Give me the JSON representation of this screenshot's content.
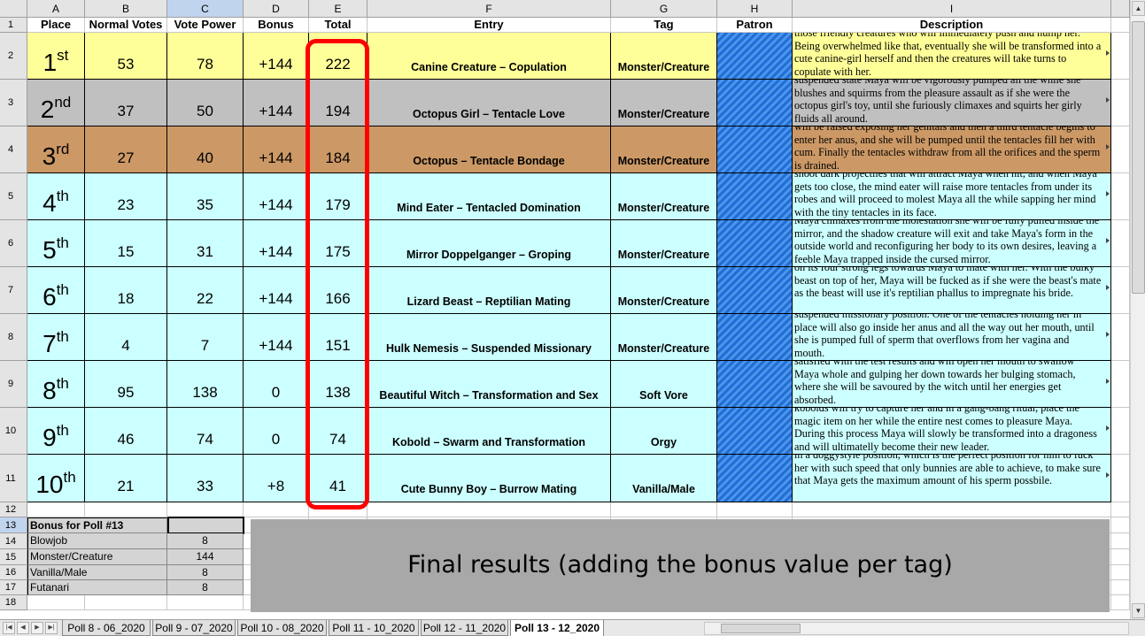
{
  "columns": [
    "A",
    "B",
    "C",
    "D",
    "E",
    "F",
    "G",
    "H",
    "I"
  ],
  "row_numbers": [
    "1",
    "2",
    "3",
    "4",
    "5",
    "6",
    "7",
    "8",
    "9",
    "10",
    "11",
    "12",
    "13",
    "14",
    "15",
    "16",
    "17",
    "18"
  ],
  "headers": {
    "place": "Place",
    "normal_votes": "Normal Votes",
    "vote_power": "Vote Power",
    "bonus": "Bonus",
    "total": "Total",
    "entry": "Entry",
    "tag": "Tag",
    "patron": "Patron",
    "description": "Description"
  },
  "rows": [
    {
      "place_num": "1",
      "place_suf": "st",
      "normal": "53",
      "power": "78",
      "bonus": "+144",
      "total": "222",
      "entry": "Canine Creature – Copulation",
      "tag": "Monster/Creature",
      "bg": "#ffff99",
      "desc": "those friendly creatures who will immediately push and hump her. Being overwhelmed like that, eventually she will be transformed into a cute canine-girl herself and then the creatures will take turns to copulate with her."
    },
    {
      "place_num": "2",
      "place_suf": "nd",
      "normal": "37",
      "power": "50",
      "bonus": "+144",
      "total": "194",
      "entry": "Octopus Girl – Tentacle Love",
      "tag": "Monster/Creature",
      "bg": "#c0c0c0",
      "desc": "suspended state Maya will be vigorously pumped all the while she blushes and squirms from the pleasure assault as if she were the octopus girl's toy, until she furiously climaxes and squirts her girly fluids all around."
    },
    {
      "place_num": "3",
      "place_suf": "rd",
      "normal": "27",
      "power": "40",
      "bonus": "+144",
      "total": "184",
      "entry": "Octopus – Tentacle Bondage",
      "tag": "Monster/Creature",
      "bg": "#cc9966",
      "desc": "will be raised exposing her genitals and then a third tentacle begins to enter her anus, and she will be pumped until the tentacles fill her with cum. Finally the tentacles withdraw from all the orifices and the sperm is drained."
    },
    {
      "place_num": "4",
      "place_suf": "th",
      "normal": "23",
      "power": "35",
      "bonus": "+144",
      "total": "179",
      "entry": "Mind Eater – Tentacled Domination",
      "tag": "Monster/Creature",
      "bg": "#ccffff",
      "desc": "shoot dark projectiles that will attract Maya when hit, and when Maya gets too close, the mind eater will raise more tentacles from under its robes and will proceed to molest Maya all the while sapping her mind with the tiny tentacles in its face."
    },
    {
      "place_num": "5",
      "place_suf": "th",
      "normal": "15",
      "power": "31",
      "bonus": "+144",
      "total": "175",
      "entry": "Mirror Doppelganger – Groping",
      "tag": "Monster/Creature",
      "bg": "#ccffff",
      "desc": "Maya climaxes from the molestation she will be fully pulled inside the mirror, and the shadow creature will exit and take Maya's form in the outside world and reconfiguring her body to its own desires, leaving a feeble Maya trapped inside the cursed mirror."
    },
    {
      "place_num": "6",
      "place_suf": "th",
      "normal": "18",
      "power": "22",
      "bonus": "+144",
      "total": "166",
      "entry": "Lizard Beast – Reptilian Mating",
      "tag": "Monster/Creature",
      "bg": "#ccffff",
      "desc": "on its four strong legs towards Maya to mate with her. With the bulky beast on top of her, Maya will be fucked as if she were the beast's mate as the beast will use it's reptilian phallus to impregnate his bride."
    },
    {
      "place_num": "7",
      "place_suf": "th",
      "normal": "4",
      "power": "7",
      "bonus": "+144",
      "total": "151",
      "entry": "Hulk Nemesis – Suspended Missionary",
      "tag": "Monster/Creature",
      "bg": "#ccffff",
      "desc": "suspended missionary position. One of the tentacles holding her in place will also go inside her anus and all the way out her mouth, until she is pumped full of sperm that overflows from her vagina and mouth."
    },
    {
      "place_num": "8",
      "place_suf": "th",
      "normal": "95",
      "power": "138",
      "bonus": "0",
      "total": "138",
      "entry": "Beautiful Witch – Transformation and Sex",
      "tag": "Soft Vore",
      "bg": "#ccffff",
      "desc": "satisfied with the test results and will open her mouth to swallow Maya whole and gulping her down towards her bulging stomach, where she will be savoured by the witch until her energies get absorbed."
    },
    {
      "place_num": "9",
      "place_suf": "th",
      "normal": "46",
      "power": "74",
      "bonus": "0",
      "total": "74",
      "entry": "Kobold – Swarm and Transformation",
      "tag": "Orgy",
      "bg": "#ccffff",
      "desc": "kobolds will try to capture her and in a gang-bang ritual, place the magic item on her while the entire nest comes to pleasure Maya. During this process Maya will slowly be transformed into a dragoness and will ultimatelly become their new leader."
    },
    {
      "place_num": "10",
      "place_suf": "th",
      "normal": "21",
      "power": "33",
      "bonus": "+8",
      "total": "41",
      "entry": "Cute Bunny Boy – Burrow Mating",
      "tag": "Vanilla/Male",
      "bg": "#ccffff",
      "desc": "in a doggystyle position, which is the perfect position for him to fuck her with such speed that only bunnies are able to achieve, to make sure that Maya gets the maximum amount of his sperm possbile."
    }
  ],
  "bonus_table": {
    "title": "Bonus for Poll #13",
    "items": [
      {
        "tag": "Blowjob",
        "value": "8"
      },
      {
        "tag": "Monster/Creature",
        "value": "144"
      },
      {
        "tag": "Vanilla/Male",
        "value": "8"
      },
      {
        "tag": "Futanari",
        "value": "8"
      }
    ]
  },
  "caption": "Final results (adding the bonus value per tag)",
  "tabs": [
    "Poll 8 - 06_2020",
    "Poll 9 - 07_2020",
    "Poll 10 - 08_2020",
    "Poll 11 - 10_2020",
    "Poll 12 - 11_2020",
    "Poll 13 - 12_2020"
  ],
  "active_tab": "Poll 13 - 12_2020",
  "colors": {
    "highlight": "#ff0000",
    "patron": "#1f6fd6",
    "selected_header": "#c0d4ee"
  }
}
